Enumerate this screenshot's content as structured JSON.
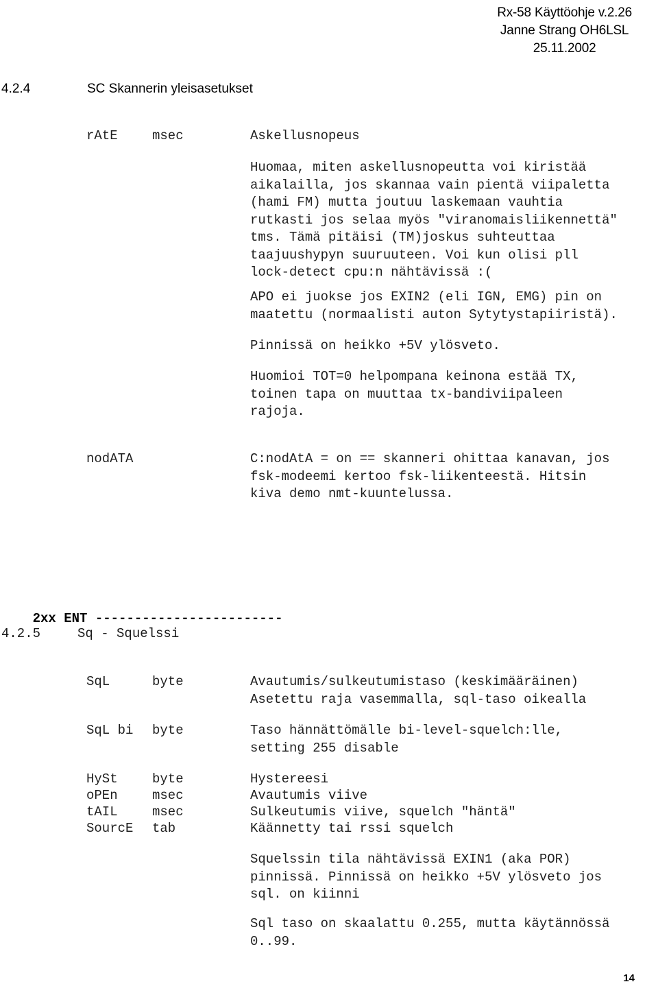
{
  "document": {
    "header": {
      "line1": "Rx-58 Käyttöohje v.2.26",
      "line2": "Janne Strang OH6LSL",
      "line3": "25.11.2002"
    },
    "page_number": "14"
  },
  "section_424": {
    "number": "4.2.4",
    "title": "SC  Skannerin yleisasetukset",
    "params": [
      {
        "label": "rAtE",
        "unit": "msec",
        "desc": "Askellusnopeus"
      },
      {
        "label": "nodATA",
        "unit": "",
        "desc": "C:nodAtA = on == skanneri ohittaa kanavan, jos\nfsk-modeemi kertoo fsk-liikenteestä. Hitsin\nkiva demo nmt-kuuntelussa."
      }
    ],
    "notes": [
      "Huomaa, miten askellusnopeutta voi kiristää\naikalailla, jos skannaa vain pientä viipaletta\n(hami FM) mutta joutuu laskemaan vauhtia\nrutkasti jos selaa myös \"viranomaisliikennettä\"\ntms. Tämä pitäisi (TM)joskus suhteuttaa\ntaajuushypyn suuruuteen. Voi kun olisi pll\nlock-detect cpu:n nähtävissä :(",
      "APO ei juokse jos EXIN2 (eli IGN, EMG) pin on\nmaatettu (normaalisti auton Sytytystapiiristä).",
      "Pinnissä on heikko +5V ylösveto.",
      "Huomioi TOT=0 helpompana keinona estää TX,\ntoinen tapa on muuttaa tx-bandiviipaleen\nrajoja."
    ]
  },
  "divider": {
    "label": "2xx ENT",
    "rule": "------------------------"
  },
  "section_425": {
    "number": "4.2.5",
    "title": "Sq - Squelssi",
    "params": [
      {
        "label": "SqL",
        "unit": "byte",
        "desc": "Avautumis/sulkeutumistaso (keskimääräinen)\nAsetettu raja vasemmalla, sql-taso oikealla"
      },
      {
        "label": "SqL bi",
        "unit": "byte",
        "desc": "Taso hännättömälle bi-level-squelch:lle,\nsetting 255 disable"
      },
      {
        "label": "HySt",
        "unit": "byte",
        "desc": "Hystereesi"
      },
      {
        "label": "oPEn",
        "unit": "msec",
        "desc": "Avautumis viive"
      },
      {
        "label": "tAIL",
        "unit": "msec",
        "desc": "Sulkeutumis viive, squelch \"häntä\""
      },
      {
        "label": "SourcE",
        "unit": "tab",
        "desc": "Käännetty tai rssi squelch"
      }
    ],
    "notes": [
      "Squelssin tila nähtävissä EXIN1 (aka POR)\npinnissä. Pinnissä on heikko +5V ylösveto jos\nsql. on kiinni",
      "Sql taso on skaalattu 0.255, mutta käytännössä\n0..99."
    ]
  }
}
